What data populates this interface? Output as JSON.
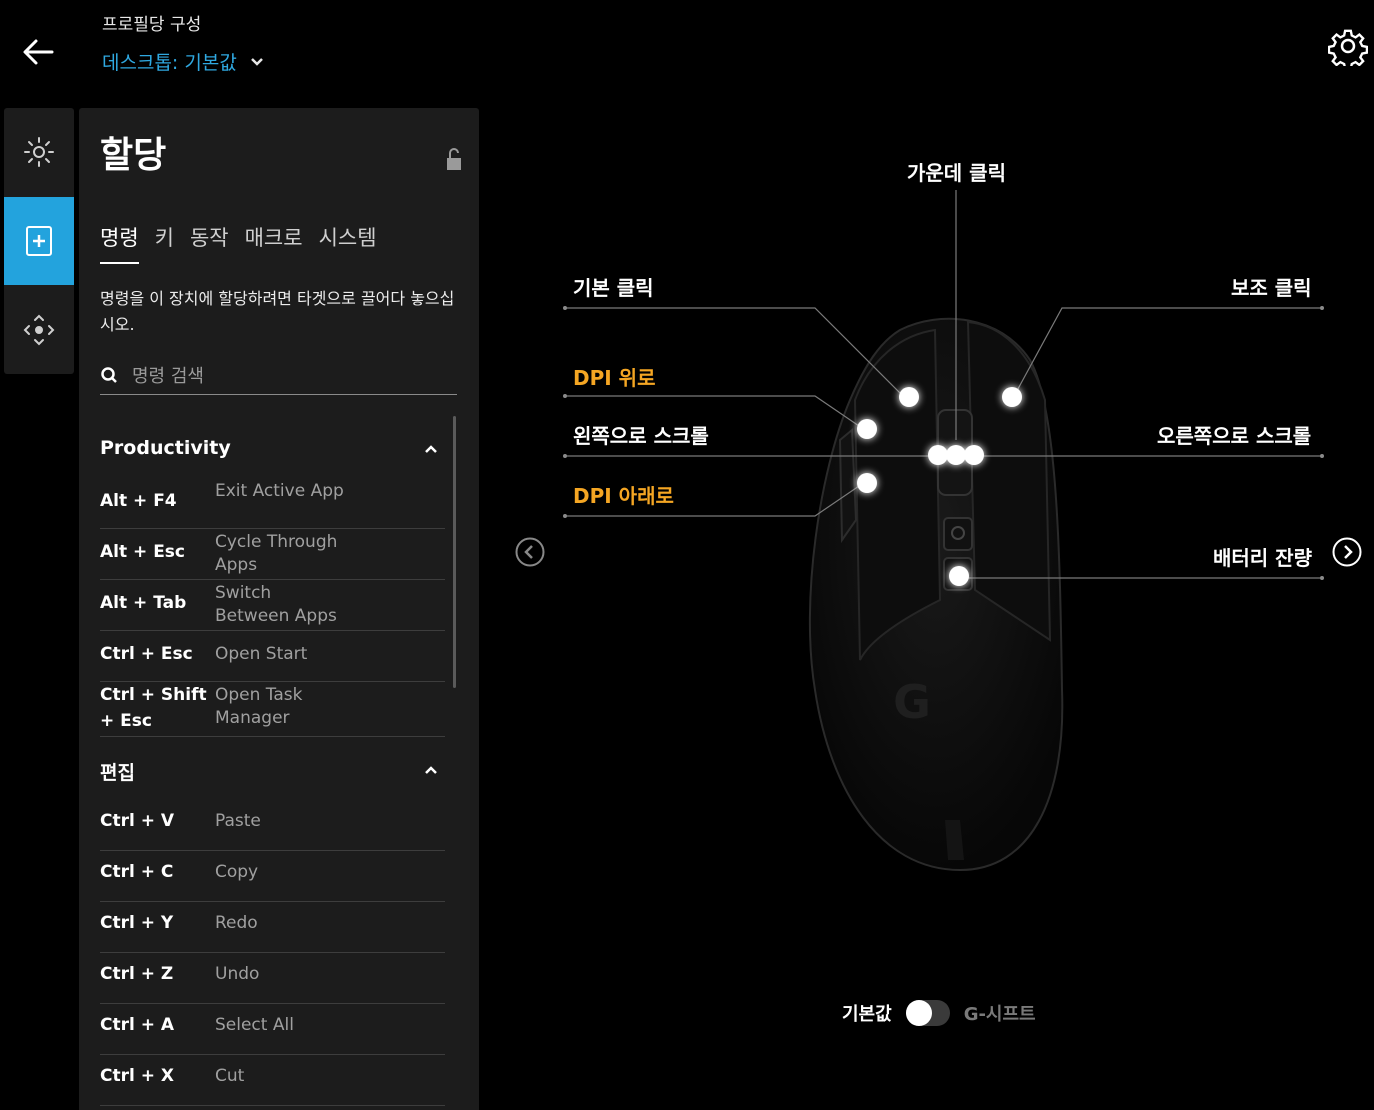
{
  "header": {
    "caption": "프로필당 구성",
    "profile": "데스크톱: 기본값"
  },
  "rail": {
    "items": [
      {
        "name": "lighting",
        "icon": "sun-icon",
        "active": false
      },
      {
        "name": "assignments",
        "icon": "plus-square-icon",
        "active": true
      },
      {
        "name": "sensitivity",
        "icon": "dpi-crosshair-icon",
        "active": false
      }
    ]
  },
  "panel": {
    "title": "할당",
    "tabs": [
      "명령",
      "키",
      "동작",
      "매크로",
      "시스템"
    ],
    "active_tab": "명령",
    "instruction": "명령을 이 장치에 할당하려면 타겟으로 끌어다 놓으십시오.",
    "search_placeholder": "명령 검색",
    "sections": [
      {
        "title": "Productivity",
        "commands": [
          {
            "key": "Alt + F4",
            "name": "Exit Active App"
          },
          {
            "key": "Alt + Esc",
            "name": "Cycle Through Apps"
          },
          {
            "key": "Alt + Tab",
            "name": "Switch Between Apps"
          },
          {
            "key": "Ctrl + Esc",
            "name": "Open Start"
          },
          {
            "key": "Ctrl + Shift + Esc",
            "name": "Open Task Manager"
          }
        ]
      },
      {
        "title": "편집",
        "commands": [
          {
            "key": "Ctrl + V",
            "name": "Paste"
          },
          {
            "key": "Ctrl + C",
            "name": "Copy"
          },
          {
            "key": "Ctrl + Y",
            "name": "Redo"
          },
          {
            "key": "Ctrl + Z",
            "name": "Undo"
          },
          {
            "key": "Ctrl + A",
            "name": "Select All"
          },
          {
            "key": "Ctrl + X",
            "name": "Cut"
          }
        ]
      }
    ]
  },
  "mouse": {
    "labels": {
      "middle_click": "가운데 클릭",
      "primary_click": "기본 클릭",
      "secondary_click": "보조 클릭",
      "dpi_up": "DPI 위로",
      "scroll_left": "왼쪽으로 스크롤",
      "scroll_right": "오른쪽으로 스크롤",
      "dpi_down": "DPI 아래로",
      "battery": "배터리 잔량"
    },
    "accent_color": "#f5a623",
    "logo": "G"
  },
  "mode": {
    "default_label": "기본값",
    "gshift_label": "G-시프트",
    "gshift_enabled": false
  },
  "colors": {
    "active_rail": "#23a3dd",
    "profile_link": "#2fa8e0",
    "panel_bg": "#1c1c1c"
  }
}
